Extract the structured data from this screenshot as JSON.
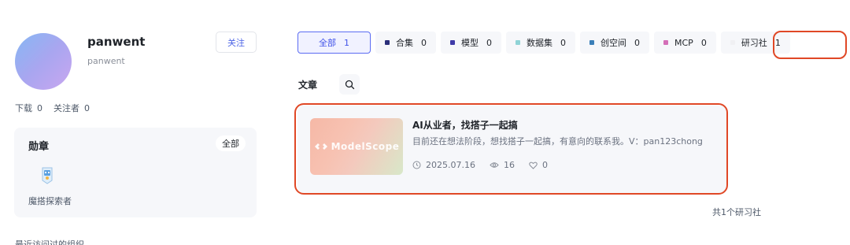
{
  "profile": {
    "name": "panwent",
    "subname": "panwent",
    "follow_label": "关注",
    "downloads_label": "下载",
    "downloads_count": "0",
    "followers_label": "关注者",
    "followers_count": "0"
  },
  "badges": {
    "title": "勋章",
    "all_label": "全部",
    "items": [
      {
        "name": "魔搭探索者",
        "icon": "badge-icon"
      }
    ]
  },
  "partial_text": "最近访问过的组织",
  "tabs": [
    {
      "label": "全部",
      "count": "1",
      "active": true
    },
    {
      "label": "合集",
      "count": "0",
      "color": "#2b2f7a"
    },
    {
      "label": "模型",
      "count": "0",
      "color": "#3e3aa8"
    },
    {
      "label": "数据集",
      "count": "0",
      "color": "#8fd3d6"
    },
    {
      "label": "创空间",
      "count": "0",
      "color": "#3a7fb8"
    },
    {
      "label": "MCP",
      "count": "0",
      "color": "#d46fb8"
    },
    {
      "label": "研习社",
      "count": "1",
      "color": "#f0f0f3"
    }
  ],
  "section": {
    "title": "文章",
    "search_icon": "search-icon"
  },
  "article": {
    "thumbnail_logo": "ModelScope",
    "title": "AI从业者，找搭子一起搞",
    "description": "目前还在想法阶段，想找搭子一起搞，有意向的联系我。V：pan123chong",
    "date": "2025.07.16",
    "views": "16",
    "likes": "0"
  },
  "total_label": "共1个研习社",
  "colors": {
    "accent": "#4b63e6",
    "highlight": "#e04826"
  }
}
